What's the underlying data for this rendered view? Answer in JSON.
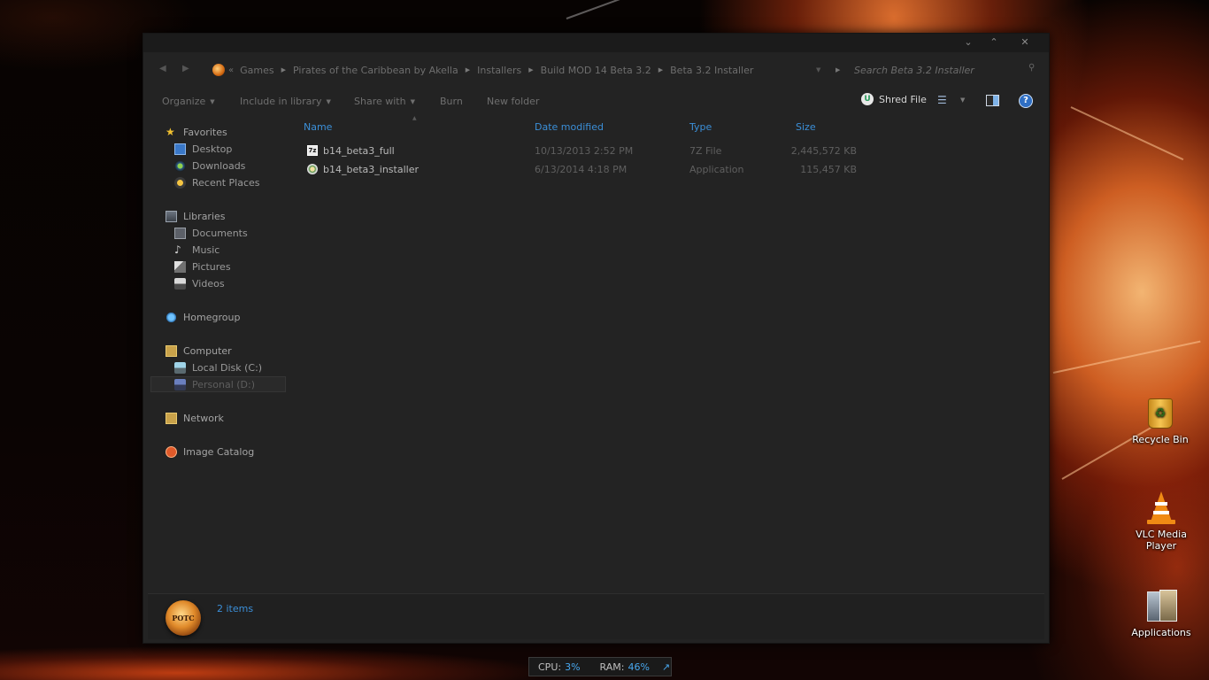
{
  "window": {
    "address": {
      "crumbs": [
        "Games",
        "Pirates of the Caribbean by Akella",
        "Installers",
        "Build MOD 14 Beta 3.2",
        "Beta 3.2 Installer"
      ],
      "search_placeholder": "Search Beta 3.2 Installer"
    },
    "toolbar": {
      "organize": "Organize",
      "include_in_library": "Include in library",
      "share_with": "Share with",
      "burn": "Burn",
      "new_folder": "New folder",
      "shred_file": "Shred File"
    },
    "nav": {
      "favorites": "Favorites",
      "desktop": "Desktop",
      "downloads": "Downloads",
      "recent_places": "Recent Places",
      "libraries": "Libraries",
      "documents": "Documents",
      "music": "Music",
      "pictures": "Pictures",
      "videos": "Videos",
      "homegroup": "Homegroup",
      "computer": "Computer",
      "local_disk": "Local Disk (C:)",
      "personal": "Personal (D:)",
      "network": "Network",
      "image_catalog": "Image Catalog"
    },
    "columns": {
      "name": "Name",
      "date_modified": "Date modified",
      "type": "Type",
      "size": "Size"
    },
    "files": [
      {
        "name": "b14_beta3_full",
        "date": "10/13/2013 2:52 PM",
        "type": "7Z File",
        "size": "2,445,572 KB"
      },
      {
        "name": "b14_beta3_installer",
        "date": "6/13/2014 4:18 PM",
        "type": "Application",
        "size": "115,457 KB"
      }
    ],
    "details": {
      "item_count": "2 items",
      "thumb_text": "POTC"
    }
  },
  "desktop": {
    "recycle_bin": "Recycle Bin",
    "vlc": "VLC Media Player",
    "applications": "Applications"
  },
  "monitor": {
    "cpu_label": "CPU:",
    "cpu_value": "3%",
    "ram_label": "RAM:",
    "ram_value": "46%"
  },
  "colors": {
    "accent_blue": "#3b8fd8",
    "window_bg": "#232323",
    "wallpaper_orange": "#e8701e"
  }
}
